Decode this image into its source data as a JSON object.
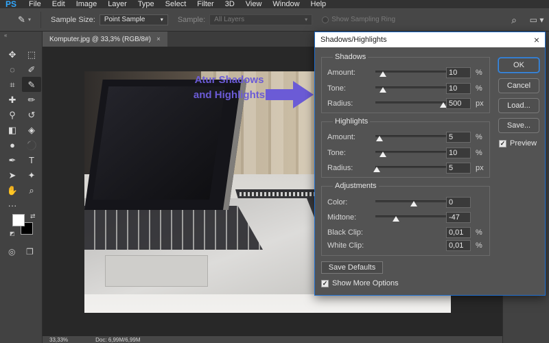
{
  "app": {
    "logo": "PS",
    "menu": [
      "File",
      "Edit",
      "Image",
      "Layer",
      "Type",
      "Select",
      "Filter",
      "3D",
      "View",
      "Window",
      "Help"
    ]
  },
  "options_bar": {
    "sample_size_label": "Sample Size:",
    "sample_size_value": "Point Sample",
    "sample_label": "Sample:",
    "sample_value": "All Layers",
    "sampling_ring_label": "Show Sampling Ring"
  },
  "document": {
    "tab_title": "Komputer.jpg @ 33,3% (RGB/8#)",
    "tab_close": "×",
    "status_zoom": "33,33%",
    "status_doc": "Doc: 6,99M/6,99M"
  },
  "annotation": {
    "text": "Atur Shadows and Highlights",
    "color": "#6b5bd6"
  },
  "dialog": {
    "title": "Shadows/Highlights",
    "close": "×",
    "shadows": {
      "label": "Shadows",
      "amount": {
        "label": "Amount:",
        "value": "10",
        "unit": "%",
        "level": 0.1
      },
      "tone": {
        "label": "Tone:",
        "value": "10",
        "unit": "%",
        "level": 0.1
      },
      "radius": {
        "label": "Radius:",
        "value": "500",
        "unit": "px",
        "level": 0.88
      }
    },
    "highlights": {
      "label": "Highlights",
      "amount": {
        "label": "Amount:",
        "value": "5",
        "unit": "%",
        "level": 0.05
      },
      "tone": {
        "label": "Tone:",
        "value": "10",
        "unit": "%",
        "level": 0.1
      },
      "radius": {
        "label": "Radius:",
        "value": "5",
        "unit": "px",
        "level": 0.02
      }
    },
    "adjustments": {
      "label": "Adjustments",
      "color": {
        "label": "Color:",
        "value": "0",
        "level": 0.5
      },
      "midtone": {
        "label": "Midtone:",
        "value": "-47",
        "level": 0.265
      },
      "black_clip": {
        "label": "Black Clip:",
        "value": "0,01",
        "unit": "%"
      },
      "white_clip": {
        "label": "White Clip:",
        "value": "0,01",
        "unit": "%"
      }
    },
    "buttons": {
      "ok": "OK",
      "cancel": "Cancel",
      "load": "Load...",
      "save": "Save...",
      "save_defaults": "Save Defaults"
    },
    "preview": {
      "label": "Preview",
      "checked": true
    },
    "show_more": {
      "label": "Show More Options",
      "checked": true
    }
  },
  "colors": {
    "accent": "#1f6fd0",
    "panel": "#535353",
    "foreground_swatch": "#ffffff",
    "background_swatch": "#000000"
  }
}
